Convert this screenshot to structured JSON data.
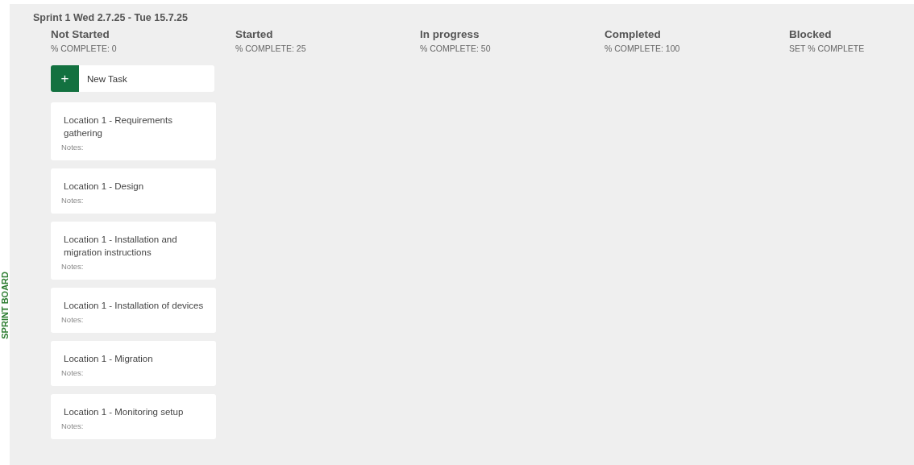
{
  "side_label": "SPRINT BOARD",
  "sprint": {
    "title": "Sprint 1 Wed 2.7.25 - Tue 15.7.25"
  },
  "columns": [
    {
      "title": "Not Started",
      "subtitle": "% COMPLETE: 0",
      "new_task": {
        "icon": "+",
        "label": "New Task"
      },
      "tasks": [
        {
          "title": "Location 1 - Requirements gathering",
          "notes": "Notes:"
        },
        {
          "title": "Location 1 - Design",
          "notes": "Notes:"
        },
        {
          "title": "Location 1 - Installation and migration instructions",
          "notes": "Notes:"
        },
        {
          "title": "Location 1 - Installation of devices",
          "notes": "Notes:"
        },
        {
          "title": "Location 1 - Migration",
          "notes": "Notes:"
        },
        {
          "title": "Location 1 - Monitoring setup",
          "notes": "Notes:"
        }
      ]
    },
    {
      "title": "Started",
      "subtitle": "% COMPLETE: 25"
    },
    {
      "title": "In progress",
      "subtitle": "% COMPLETE: 50"
    },
    {
      "title": "Completed",
      "subtitle": "% COMPLETE: 100"
    },
    {
      "title": "Blocked",
      "subtitle": "SET % COMPLETE"
    }
  ]
}
